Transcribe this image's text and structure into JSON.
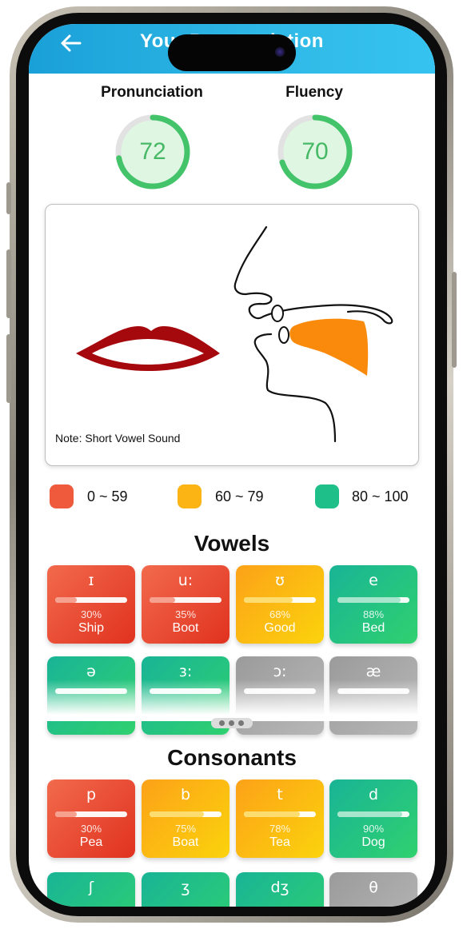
{
  "header": {
    "title": "Your Pronunciation"
  },
  "scores": [
    {
      "label": "Pronunciation",
      "value": "72",
      "fraction": 0.72
    },
    {
      "label": "Fluency",
      "value": "70",
      "fraction": 0.7
    }
  ],
  "illustration": {
    "note": "Note: Short Vowel Sound"
  },
  "legend": [
    {
      "range": "0 ~ 59",
      "color": "#ef5a3c"
    },
    {
      "range": "60 ~ 79",
      "color": "#fbb414"
    },
    {
      "range": "80 ~ 100",
      "color": "#1fbf8a"
    }
  ],
  "vowels": {
    "title": "Vowels",
    "row1": [
      {
        "symbol": "ɪ",
        "percent": "30%",
        "word": "Ship",
        "fraction": 0.3
      },
      {
        "symbol": "u:",
        "percent": "35%",
        "word": "Boot",
        "fraction": 0.35
      },
      {
        "symbol": "ʊ",
        "percent": "68%",
        "word": "Good",
        "fraction": 0.68
      },
      {
        "symbol": "e",
        "percent": "88%",
        "word": "Bed",
        "fraction": 0.88
      }
    ],
    "row2": [
      {
        "symbol": "ə"
      },
      {
        "symbol": "ɜ:"
      },
      {
        "symbol": "ɔ:"
      },
      {
        "symbol": "æ"
      }
    ]
  },
  "consonants": {
    "title": "Consonants",
    "row1": [
      {
        "symbol": "p",
        "percent": "30%",
        "word": "Pea",
        "fraction": 0.3
      },
      {
        "symbol": "b",
        "percent": "75%",
        "word": "Boat",
        "fraction": 0.75
      },
      {
        "symbol": "t",
        "percent": "78%",
        "word": "Tea",
        "fraction": 0.78
      },
      {
        "symbol": "d",
        "percent": "90%",
        "word": "Dog",
        "fraction": 0.9
      }
    ],
    "row2": [
      {
        "symbol": "ʃ"
      },
      {
        "symbol": "ʒ"
      },
      {
        "symbol": "dʒ"
      },
      {
        "symbol": "θ"
      }
    ]
  }
}
